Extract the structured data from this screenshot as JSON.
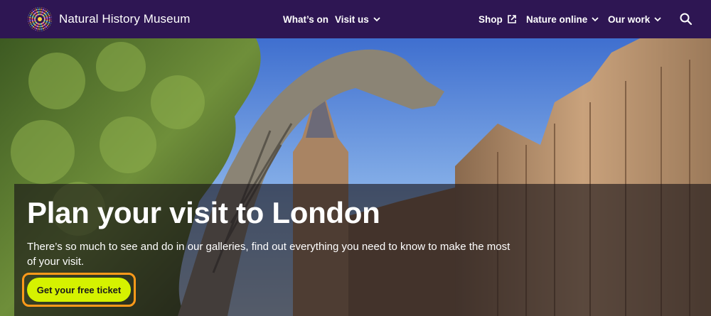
{
  "brand": {
    "name": "Natural History Museum",
    "logo_icon": "nhm-starburst-logo-icon"
  },
  "nav": {
    "whats_on": "What’s on",
    "visit_us": "Visit us",
    "shop": "Shop",
    "nature_online": "Nature online",
    "our_work": "Our work",
    "search_icon": "search-icon",
    "chevron_icon": "chevron-down-icon",
    "external_icon": "external-link-icon"
  },
  "hero": {
    "title": "Plan your visit to London",
    "intro": "There’s so much to see and do in our galleries, find out everything you need to know to make the most of your visit.",
    "cta_label": "Get your free ticket"
  },
  "colors": {
    "nav_bg": "#2e1653",
    "cta_bg": "#d5f200",
    "cta_focus": "#ff9a1a",
    "overlay": "#161216"
  }
}
